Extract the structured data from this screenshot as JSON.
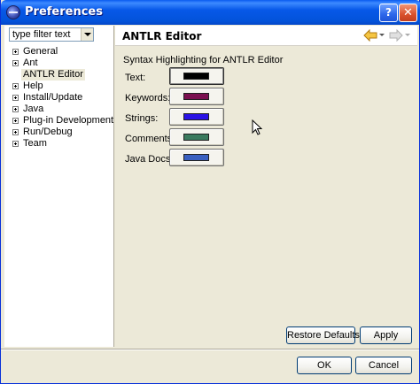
{
  "window": {
    "title": "Preferences",
    "help_label": "?",
    "close_label": "✕"
  },
  "filter": {
    "value": "type filter text"
  },
  "tree": {
    "items": [
      {
        "label": "General",
        "expandable": true
      },
      {
        "label": "Ant",
        "expandable": true
      },
      {
        "label": "ANTLR Editor",
        "expandable": false,
        "selected": true
      },
      {
        "label": "Help",
        "expandable": true
      },
      {
        "label": "Install/Update",
        "expandable": true
      },
      {
        "label": "Java",
        "expandable": true
      },
      {
        "label": "Plug-in Development",
        "expandable": true
      },
      {
        "label": "Run/Debug",
        "expandable": true
      },
      {
        "label": "Team",
        "expandable": true
      }
    ]
  },
  "page": {
    "title": "ANTLR Editor",
    "section_label": "Syntax Highlighting for ANTLR Editor",
    "colors": [
      {
        "label": "Text:",
        "color": "#000000"
      },
      {
        "label": "Keywords:",
        "color": "#7b0f4f"
      },
      {
        "label": "Strings:",
        "color": "#2a12e6"
      },
      {
        "label": "Comments:",
        "color": "#3a7a5e"
      },
      {
        "label": "Java Docs:",
        "color": "#3a60c0"
      }
    ],
    "restore_defaults_label": "Restore Defaults",
    "apply_label": "Apply"
  },
  "footer": {
    "ok_label": "OK",
    "cancel_label": "Cancel"
  },
  "icons": {
    "nav_back": "back-arrow-icon",
    "nav_forward": "forward-arrow-icon",
    "app": "eclipse-icon"
  }
}
